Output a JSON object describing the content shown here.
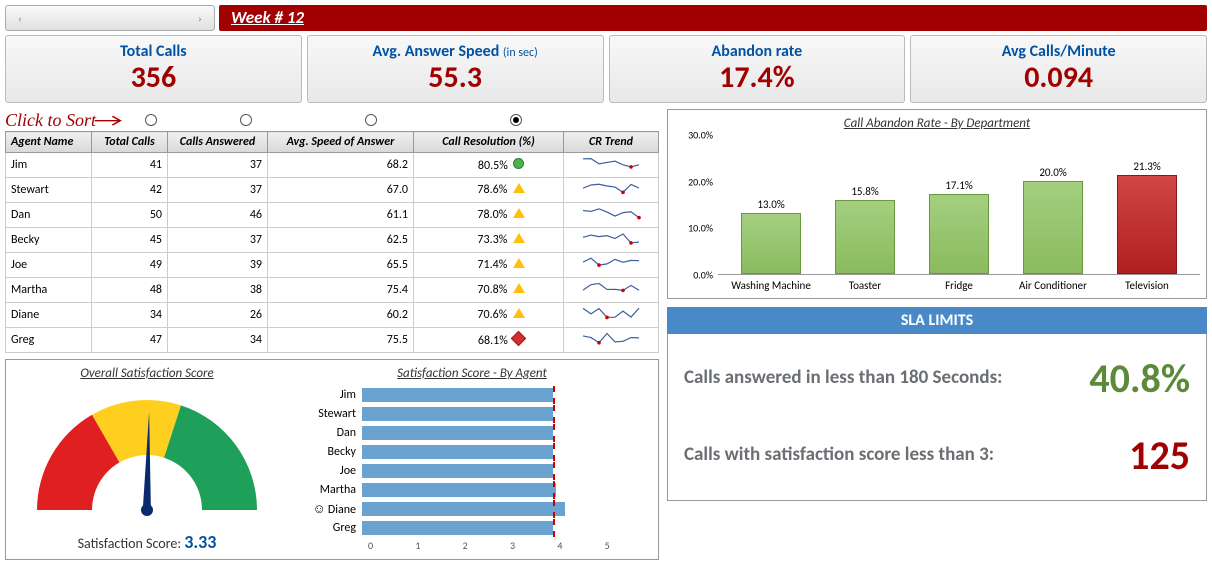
{
  "week_label": "Week # 12",
  "kpis": {
    "total_calls_label": "Total Calls",
    "total_calls": "356",
    "answer_speed_label": "Avg. Answer Speed",
    "answer_speed_sub": "(in sec)",
    "answer_speed": "55.3",
    "abandon_label": "Abandon rate",
    "abandon": "17.4%",
    "calls_min_label": "Avg Calls/Minute",
    "calls_min": "0.094"
  },
  "sort_label": "Click to Sort",
  "cols": {
    "c1": "Agent Name",
    "c2": "Total Calls",
    "c3": "Calls Answered",
    "c4": "Avg. Speed of Answer",
    "c5": "Call Resolution (%)",
    "c6": "CR Trend"
  },
  "agents": [
    {
      "name": "Jim",
      "calls": "41",
      "ans": "37",
      "speed": "68.2",
      "res": "80.5%",
      "ind": "g"
    },
    {
      "name": "Stewart",
      "calls": "42",
      "ans": "37",
      "speed": "67.0",
      "res": "78.6%",
      "ind": "y"
    },
    {
      "name": "Dan",
      "calls": "50",
      "ans": "46",
      "speed": "61.1",
      "res": "78.0%",
      "ind": "y"
    },
    {
      "name": "Becky",
      "calls": "45",
      "ans": "37",
      "speed": "62.5",
      "res": "73.3%",
      "ind": "y"
    },
    {
      "name": "Joe",
      "calls": "49",
      "ans": "39",
      "speed": "65.5",
      "res": "71.4%",
      "ind": "y"
    },
    {
      "name": "Martha",
      "calls": "48",
      "ans": "38",
      "speed": "75.4",
      "res": "70.8%",
      "ind": "y"
    },
    {
      "name": "Diane",
      "calls": "34",
      "ans": "26",
      "speed": "60.2",
      "res": "70.6%",
      "ind": "y"
    },
    {
      "name": "Greg",
      "calls": "47",
      "ans": "34",
      "speed": "75.5",
      "res": "68.1%",
      "ind": "r"
    }
  ],
  "gauge": {
    "title": "Overall Satisfaction Score",
    "label": "Satisfaction Score:",
    "value": "3.33"
  },
  "sat_by_agent": {
    "title": "Satisfaction Score - By Agent",
    "max": 5,
    "target": 3.3,
    "rows": [
      {
        "name": "Jim",
        "v": 3.3
      },
      {
        "name": "Stewart",
        "v": 3.3
      },
      {
        "name": "Dan",
        "v": 3.3
      },
      {
        "name": "Becky",
        "v": 3.3
      },
      {
        "name": "Joe",
        "v": 3.3
      },
      {
        "name": "Martha",
        "v": 3.35
      },
      {
        "name": "Diane",
        "v": 3.5,
        "smiley": true
      },
      {
        "name": "Greg",
        "v": 3.3
      }
    ],
    "ticks": [
      "0",
      "1",
      "2",
      "3",
      "4",
      "5"
    ]
  },
  "chart_data": {
    "type": "bar",
    "title": "Call Abandon Rate - By Department",
    "categories": [
      "Washing Machine",
      "Toaster",
      "Fridge",
      "Air Conditioner",
      "Television"
    ],
    "values": [
      13.0,
      15.8,
      17.1,
      20.0,
      21.3
    ],
    "labels": [
      "13.0%",
      "15.8%",
      "17.1%",
      "20.0%",
      "21.3%"
    ],
    "highlight_index": 4,
    "ylabel": "",
    "ylim": [
      0,
      30
    ],
    "yticks": [
      "0.0%",
      "10.0%",
      "20.0%",
      "30.0%"
    ]
  },
  "sla": {
    "title": "SLA LIMITS",
    "r1_text": "Calls answered in less than 180 Seconds:",
    "r1_val": "40.8%",
    "r2_text": "Calls with satisfaction score less than 3:",
    "r2_val": "125"
  }
}
